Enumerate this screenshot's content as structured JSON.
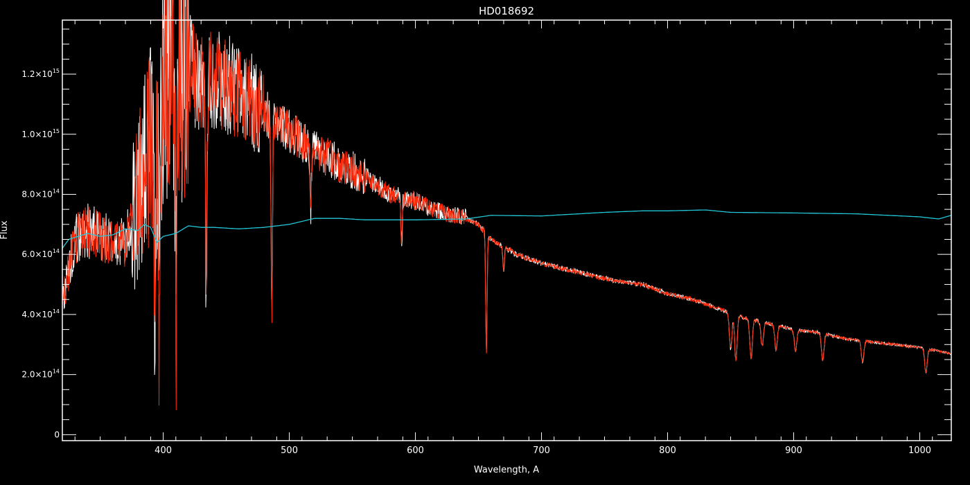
{
  "chart_data": {
    "type": "line",
    "title": "HD018692",
    "xlabel": "Wavelength, A",
    "ylabel": "Flux",
    "xlim": [
      320,
      1025
    ],
    "ylim": [
      -20000000000000,
      1380000000000000
    ],
    "x_ticks": [
      400,
      500,
      600,
      700,
      800,
      900,
      1000
    ],
    "x_tick_labels": [
      "400",
      "500",
      "600",
      "700",
      "800",
      "900",
      "1000"
    ],
    "y_ticks": [
      0,
      200000000000000,
      400000000000000,
      600000000000000,
      800000000000000,
      1000000000000000,
      1200000000000000
    ],
    "y_tick_labels": [
      {
        "mantissa": "0",
        "exponent": ""
      },
      {
        "mantissa": "2.0×10",
        "exponent": "14"
      },
      {
        "mantissa": "4.0×10",
        "exponent": "14"
      },
      {
        "mantissa": "6.0×10",
        "exponent": "14"
      },
      {
        "mantissa": "8.0×10",
        "exponent": "14"
      },
      {
        "mantissa": "1.0×10",
        "exponent": "15"
      },
      {
        "mantissa": "1.2×10",
        "exponent": "15"
      }
    ],
    "background": "#000000",
    "axis_color": "#ffffff",
    "series": [
      {
        "color": "#ffffff",
        "style": "observed spectrum (noisy)",
        "x": [
          320,
          330,
          340,
          350,
          360,
          370,
          375,
          380,
          385,
          390,
          395,
          400,
          405,
          410,
          420,
          430,
          440,
          450,
          460,
          470,
          480,
          490,
          500,
          520,
          540,
          560,
          580,
          600,
          620,
          640,
          650,
          660,
          680,
          700,
          720,
          740,
          760,
          780,
          800,
          820,
          840,
          860,
          880,
          900,
          920,
          940,
          960,
          980,
          1000,
          1025
        ],
        "y": [
          450000000000000,
          650000000000000,
          680000000000000,
          660000000000000,
          640000000000000,
          640000000000000,
          700000000000000,
          800000000000000,
          880000000000000,
          950000000000000,
          950000000000000,
          1180000000000000,
          1200000000000000,
          1150000000000000,
          1230000000000000,
          1160000000000000,
          1190000000000000,
          1170000000000000,
          1140000000000000,
          1110000000000000,
          1070000000000000,
          1050000000000000,
          1010000000000000,
          950000000000000,
          900000000000000,
          860000000000000,
          800000000000000,
          780000000000000,
          740000000000000,
          720000000000000,
          700000000000000,
          650000000000000,
          600000000000000,
          570000000000000,
          550000000000000,
          530000000000000,
          510000000000000,
          500000000000000,
          470000000000000,
          450000000000000,
          420000000000000,
          390000000000000,
          370000000000000,
          350000000000000,
          340000000000000,
          320000000000000,
          310000000000000,
          300000000000000,
          290000000000000,
          270000000000000
        ]
      },
      {
        "color": "#ff2a0a",
        "style": "model spectrum",
        "x": [
          320,
          330,
          340,
          350,
          360,
          370,
          375,
          380,
          385,
          390,
          395,
          400,
          405,
          410,
          420,
          430,
          440,
          450,
          460,
          470,
          480,
          490,
          500,
          520,
          540,
          560,
          580,
          600,
          620,
          640,
          650,
          660,
          680,
          700,
          720,
          740,
          760,
          780,
          800,
          820,
          840,
          860,
          880,
          900,
          920,
          940,
          960,
          980,
          1000,
          1025
        ],
        "y": [
          450000000000000,
          650000000000000,
          680000000000000,
          660000000000000,
          640000000000000,
          640000000000000,
          700000000000000,
          800000000000000,
          880000000000000,
          950000000000000,
          950000000000000,
          1180000000000000,
          1200000000000000,
          1150000000000000,
          1230000000000000,
          1160000000000000,
          1190000000000000,
          1170000000000000,
          1140000000000000,
          1110000000000000,
          1070000000000000,
          1050000000000000,
          1010000000000000,
          950000000000000,
          900000000000000,
          860000000000000,
          800000000000000,
          780000000000000,
          740000000000000,
          720000000000000,
          700000000000000,
          650000000000000,
          600000000000000,
          570000000000000,
          550000000000000,
          530000000000000,
          510000000000000,
          500000000000000,
          470000000000000,
          450000000000000,
          420000000000000,
          390000000000000,
          370000000000000,
          350000000000000,
          340000000000000,
          320000000000000,
          310000000000000,
          300000000000000,
          290000000000000,
          270000000000000
        ]
      },
      {
        "color": "#22c8d8",
        "style": "ratio / smooth curve",
        "x": [
          320,
          325,
          340,
          350,
          360,
          370,
          380,
          385,
          390,
          395,
          400,
          410,
          420,
          430,
          440,
          460,
          480,
          500,
          520,
          540,
          560,
          600,
          640,
          660,
          700,
          750,
          780,
          800,
          830,
          850,
          900,
          950,
          1000,
          1015,
          1025
        ],
        "y": [
          620000000000000,
          650000000000000,
          670000000000000,
          660000000000000,
          665000000000000,
          685000000000000,
          680000000000000,
          700000000000000,
          690000000000000,
          640000000000000,
          660000000000000,
          670000000000000,
          695000000000000,
          690000000000000,
          690000000000000,
          685000000000000,
          690000000000000,
          700000000000000,
          720000000000000,
          720000000000000,
          715000000000000,
          715000000000000,
          718000000000000,
          730000000000000,
          728000000000000,
          740000000000000,
          745000000000000,
          745000000000000,
          748000000000000,
          740000000000000,
          738000000000000,
          735000000000000,
          725000000000000,
          718000000000000,
          730000000000000
        ]
      }
    ],
    "absorption_lines": [
      {
        "x": 393.4,
        "depth": 570000000000000
      },
      {
        "x": 396.8,
        "depth": 600000000000000
      },
      {
        "x": 410.2,
        "depth": 700000000000000
      },
      {
        "x": 434.0,
        "depth": 720000000000000
      },
      {
        "x": 486.1,
        "depth": 690000000000000
      },
      {
        "x": 517.0,
        "depth": 200000000000000
      },
      {
        "x": 589.0,
        "depth": 160000000000000
      },
      {
        "x": 656.3,
        "depth": 400000000000000
      },
      {
        "x": 670.0,
        "depth": 80000000000000
      },
      {
        "x": 850.0,
        "depth": 120000000000000
      },
      {
        "x": 854.2,
        "depth": 150000000000000
      },
      {
        "x": 866.2,
        "depth": 130000000000000
      },
      {
        "x": 875.0,
        "depth": 80000000000000
      },
      {
        "x": 886.0,
        "depth": 80000000000000
      },
      {
        "x": 901.5,
        "depth": 70000000000000
      },
      {
        "x": 923.0,
        "depth": 90000000000000
      },
      {
        "x": 954.6,
        "depth": 70000000000000
      },
      {
        "x": 1004.9,
        "depth": 80000000000000
      }
    ]
  }
}
